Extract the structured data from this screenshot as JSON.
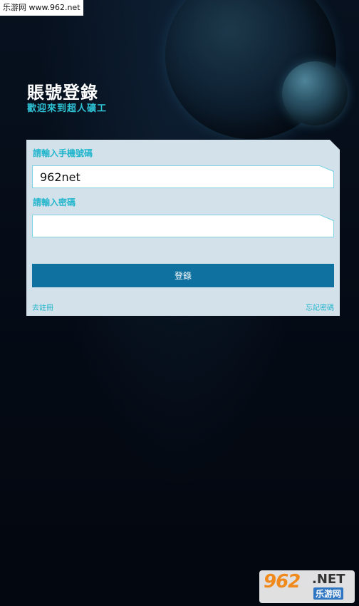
{
  "watermark_top": "乐游网 www.962.net",
  "header": {
    "title": "賬號登錄",
    "subtitle": "歡迎來到超人礦工"
  },
  "form": {
    "phone_label": "請輸入手機號碼",
    "phone_value": "962net",
    "password_label": "請輸入密碼",
    "password_value": "",
    "login_button": "登錄",
    "register_link": "去註冊",
    "forgot_link": "忘記密碼"
  },
  "watermark_bottom": {
    "logo": "962",
    "net": ".NET",
    "cn": "乐游网"
  },
  "colors": {
    "background": "#050b16",
    "accent": "#22b6cd",
    "button": "#0f71a0",
    "card": "#d3e1ea"
  }
}
